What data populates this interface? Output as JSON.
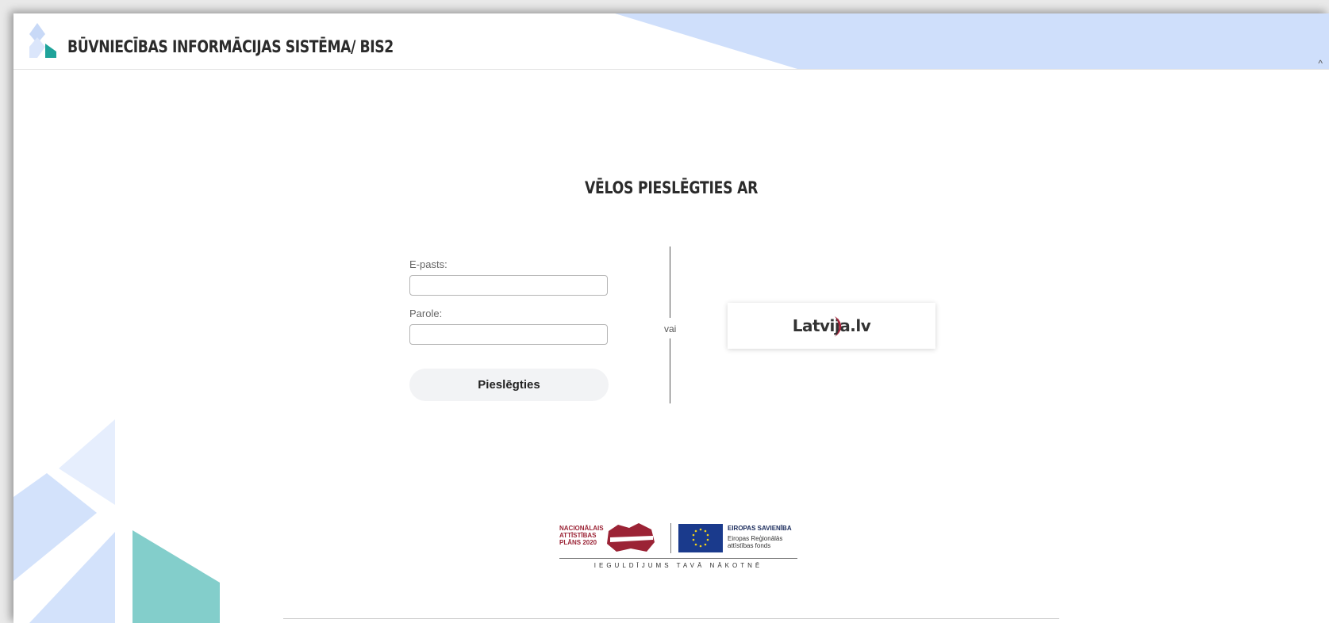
{
  "header": {
    "title": "BŪVNIECĪBAS INFORMĀCIJAS SISTĒMA/ BIS2",
    "collapse_glyph": "^"
  },
  "login": {
    "heading": "VĒLOS PIESLĒGTIES AR",
    "email_label": "E-pasts:",
    "email_value": "",
    "password_label": "Parole:",
    "password_value": "",
    "submit_label": "Pieslēgties",
    "or_text": "vai"
  },
  "latvija": {
    "text_before": "Latvi",
    "text_mid": "j",
    "text_after": "a.lv"
  },
  "funding": {
    "national_plan": "NACIONĀLAIS ATTĪSTĪBAS PLĀNS 2020",
    "eu_title": "EIROPAS SAVIENĪBA",
    "eu_fund": "Eiropas Reģionālās attīstības fonds",
    "motto": "IEGULDĪJUMS TAVĀ NĀKOTNĒ"
  },
  "colors": {
    "header_band": "#cfdffb",
    "teal": "#1fa39a",
    "deco_blue": "#d3e2fb",
    "latvija_red": "#a4243b",
    "eu_blue": "#1a3a8c"
  }
}
